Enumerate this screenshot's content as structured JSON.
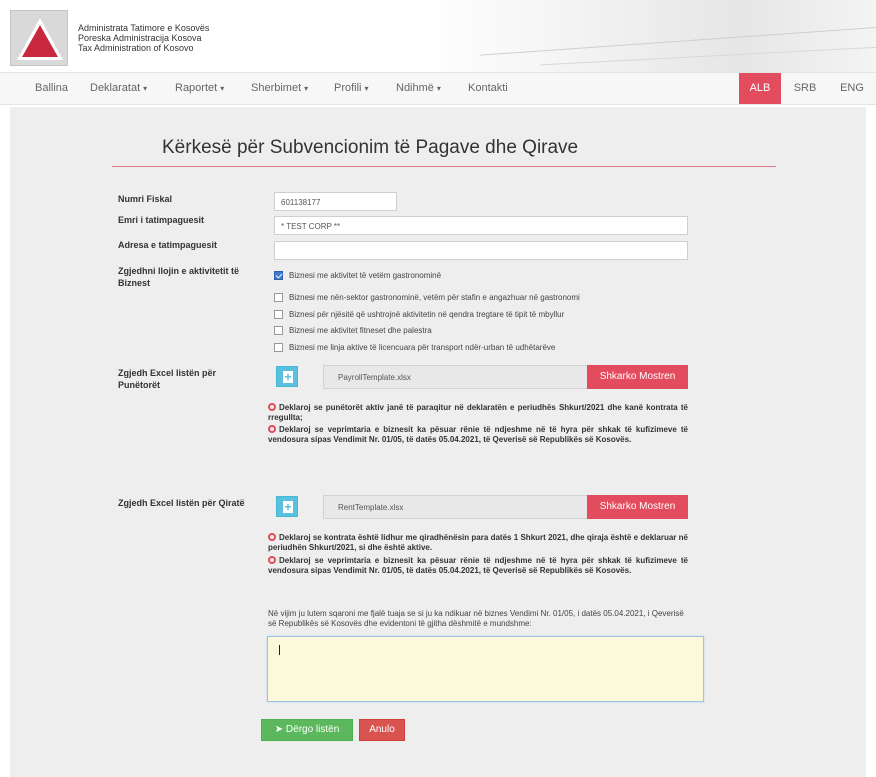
{
  "header": {
    "org_lines": [
      "Administrata Tatimore e Kosovës",
      "Poreska Administracija Kosova",
      "Tax Administration of Kosovo"
    ]
  },
  "nav": {
    "items": [
      {
        "label": "Ballina",
        "dropdown": false
      },
      {
        "label": "Deklaratat",
        "dropdown": true
      },
      {
        "label": "Raportet",
        "dropdown": true
      },
      {
        "label": "Sherbimet",
        "dropdown": true
      },
      {
        "label": "Profili",
        "dropdown": true
      },
      {
        "label": "Ndihmë",
        "dropdown": true
      },
      {
        "label": "Kontakti",
        "dropdown": false
      }
    ],
    "caret": "▾",
    "languages": [
      {
        "label": "ALB",
        "active": true
      },
      {
        "label": "SRB",
        "active": false
      },
      {
        "label": "ENG",
        "active": false
      }
    ]
  },
  "form": {
    "title": "Kërkesë për Subvencionim të Pagave dhe Qirave",
    "fiscal_number": {
      "label": "Numri Fiskal",
      "value": "601138177"
    },
    "taxpayer_name": {
      "label": "Emri i tatimpaguesit",
      "value": "* TEST CORP **"
    },
    "taxpayer_address": {
      "label": "Adresa e tatimpaguesit",
      "value": ""
    },
    "business_type": {
      "label": "Zgjedhni llojin e aktivitetit të Biznest",
      "options": [
        {
          "label": "Biznesi me aktivitet të vetëm gastronominë",
          "checked": true
        },
        {
          "label": "Biznesi me nën-sektor gastronominë, vetëm për stafin e angazhuar në gastronomi",
          "checked": false
        },
        {
          "label": "Biznesi për njësitë që ushtrojnë aktivitetin në qendra tregtare të tipit të mbyllur",
          "checked": false
        },
        {
          "label": "Biznesi me aktivitet fitneset dhe palestra",
          "checked": false
        },
        {
          "label": "Biznesi me linja aktive të licencuara për transport ndër-urban të udhëtarëve",
          "checked": false
        }
      ]
    },
    "workers_excel": {
      "label": "Zgjedh Excel listën për Punëtorët",
      "file": "PayrollTemplate.xlsx",
      "download": "Shkarko Mostren",
      "declarations": [
        "Deklaroj se punëtorët aktiv janë të paraqitur në deklaratën e periudhës Shkurt/2021 dhe kanë kontrata të rregullta;",
        "Deklaroj se veprimtaria e biznesit ka pësuar rënie të ndjeshme në të hyra për shkak të kufizimeve të vendosura sipas Vendimit Nr. 01/05, të datës 05.04.2021, të Qeverisë së Republikës së Kosovës."
      ]
    },
    "rent_excel": {
      "label": "Zgjedh Excel listën për Qiratë",
      "file": "RentTemplate.xlsx",
      "download": "Shkarko Mostren",
      "declarations": [
        "Deklaroj se kontrata është lidhur me qiradhënësin para datës 1 Shkurt 2021, dhe qiraja është e deklaruar në periudhën Shkurt/2021, si dhe është aktive.",
        "Deklaroj se veprimtaria e biznesit ka pësuar rënie të ndjeshme në të hyra për shkak të kufizimeve të vendosura sipas Vendimit Nr. 01/05, të datës 05.04.2021, të Qeverisë së Republikës së Kosovës."
      ]
    },
    "explanation_note": "Në vijim ju lutem sqaroni me fjalë tuaja se si ju ka ndikuar në biznes Vendimi Nr. 01/05, i datës 05.04.2021, i Qeverisë së Republikës së Kosovës dhe evidentoni të gjitha dëshmitë e mundshme:",
    "explanation_value": "",
    "submit_label": "Dërgo listën",
    "cancel_label": "Anulo"
  },
  "colors": {
    "accent": "#e34b5e",
    "info": "#5bc0de",
    "success": "#5cb85c",
    "danger": "#d9534f"
  }
}
